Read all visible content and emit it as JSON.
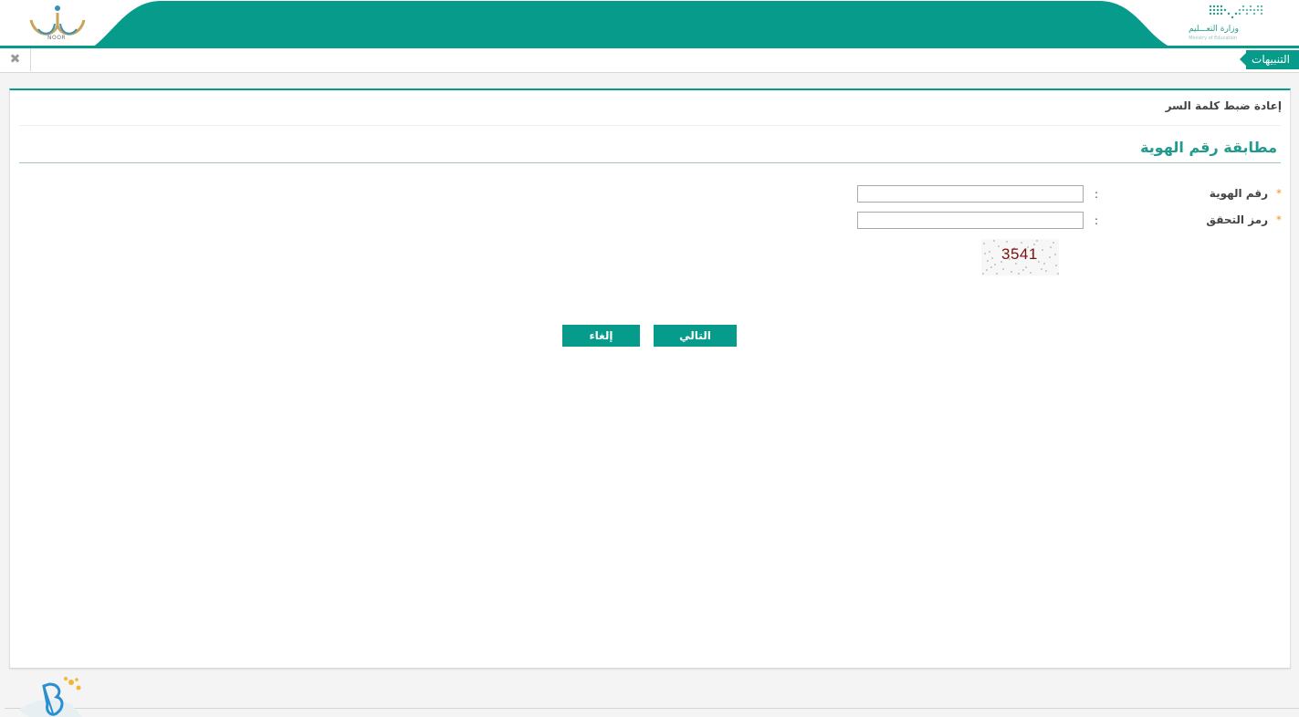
{
  "header": {
    "noor_logo_text": "NOOR",
    "moe_name_ar": "وزارة التعـــليم",
    "moe_name_en": "Ministry of Education",
    "brand_color": "#079b8b"
  },
  "alerts_bar": {
    "label": "التنبيهات",
    "close_icon": "✖"
  },
  "page": {
    "title": "إعادة ضبط كلمة السر",
    "section_title": "مطابقة رقم الهوية"
  },
  "form": {
    "required_mark": "*",
    "colon": ":",
    "fields": [
      {
        "label": "رقم الهوية",
        "value": ""
      },
      {
        "label": "رمز التحقق",
        "value": ""
      }
    ],
    "captcha_text": "3541"
  },
  "buttons": {
    "next": "التالي",
    "cancel": "إلغاء"
  }
}
